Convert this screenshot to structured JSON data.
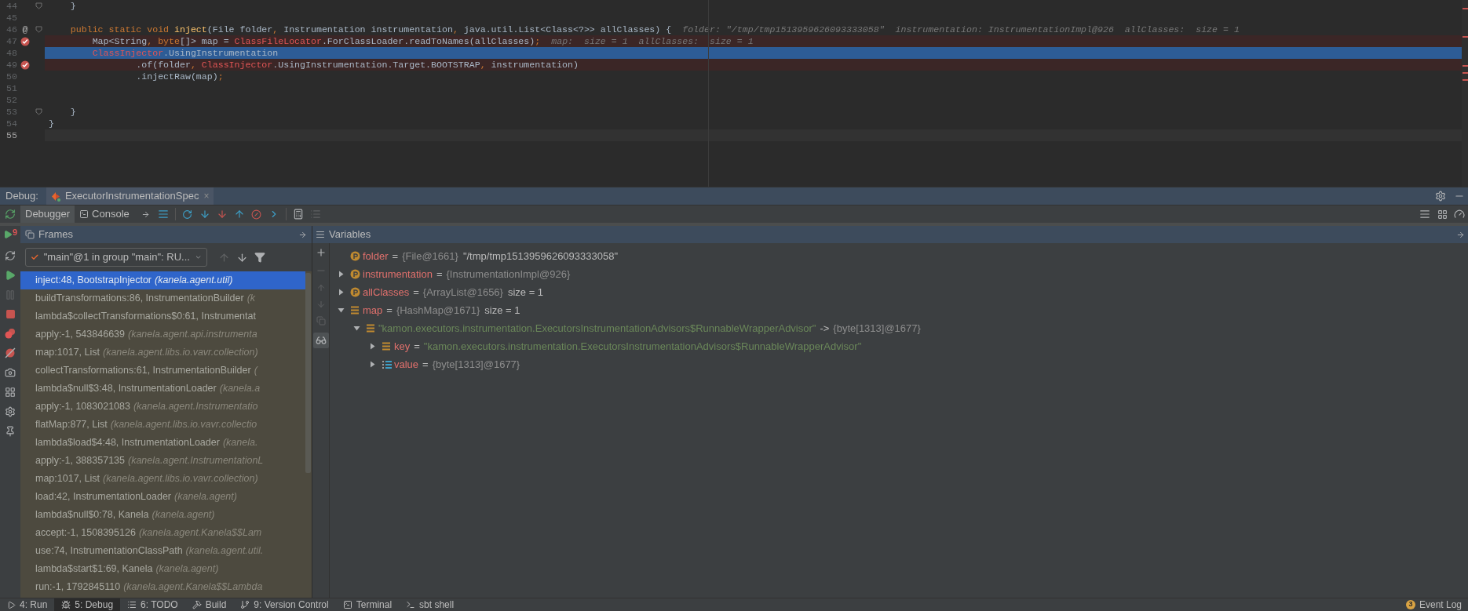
{
  "editor": {
    "lines": [
      {
        "number": "44",
        "breakpoint": false,
        "current": false,
        "highlighted": false,
        "fold": true,
        "tokens": [
          {
            "text": "    }",
            "kind": "plain"
          }
        ]
      },
      {
        "number": "45",
        "breakpoint": false,
        "current": false,
        "highlighted": false,
        "fold": false
      },
      {
        "number": "46",
        "breakpoint": false,
        "current": false,
        "highlighted": false,
        "marker": "@",
        "fold": true,
        "tokens": [
          {
            "text": "    public static void ",
            "kind": "keyword"
          },
          {
            "text": "inject",
            "kind": "method"
          },
          {
            "text": "(File folder",
            "kind": "plain"
          },
          {
            "text": ",",
            "kind": "keyword"
          },
          {
            "text": " Instrumentation instrumentation",
            "kind": "plain"
          },
          {
            "text": ",",
            "kind": "keyword"
          },
          {
            "text": " java.util.List<Class<?>> allClasses) {",
            "kind": "plain"
          },
          {
            "text": "folder: \"/tmp/tmp1513959626093333058\"  instrumentation: InstrumentationImpl@926  allClasses:  size = 1",
            "kind": "hint"
          }
        ]
      },
      {
        "number": "47",
        "breakpoint": true,
        "current": false,
        "highlighted": false,
        "fold": false,
        "tokens": [
          {
            "text": "        Map<String",
            "kind": "plain"
          },
          {
            "text": ",",
            "kind": "keyword"
          },
          {
            "text": " byte",
            "kind": "keyword"
          },
          {
            "text": "[]> map = ",
            "kind": "plain"
          },
          {
            "text": "ClassFileLocator",
            "kind": "class"
          },
          {
            "text": ".ForClassLoader.readToNames(allClasses)",
            "kind": "plain"
          },
          {
            "text": ";",
            "kind": "keyword"
          },
          {
            "text": "map:  size = 1  allClasses:  size = 1",
            "kind": "hint"
          }
        ]
      },
      {
        "number": "48",
        "breakpoint": false,
        "current": true,
        "highlighted": false,
        "fold": false,
        "tokens": [
          {
            "text": "        ClassInjector",
            "kind": "class"
          },
          {
            "text": ".UsingInstrumentation",
            "kind": "plain"
          }
        ]
      },
      {
        "number": "49",
        "breakpoint": true,
        "current": false,
        "highlighted": false,
        "fold": false,
        "tokens": [
          {
            "text": "                .of(folder",
            "kind": "plain"
          },
          {
            "text": ", ",
            "kind": "keyword"
          },
          {
            "text": "ClassInjector",
            "kind": "class"
          },
          {
            "text": ".UsingInstrumentation.Target.BOOTSTRAP",
            "kind": "plain"
          },
          {
            "text": ",",
            "kind": "keyword"
          },
          {
            "text": " instrumentation)",
            "kind": "plain"
          }
        ]
      },
      {
        "number": "50",
        "breakpoint": false,
        "current": false,
        "highlighted": false,
        "fold": false,
        "tokens": [
          {
            "text": "                .injectRaw(map)",
            "kind": "plain"
          },
          {
            "text": ";",
            "kind": "keyword"
          }
        ]
      },
      {
        "number": "51",
        "breakpoint": false,
        "current": false,
        "highlighted": false,
        "fold": false
      },
      {
        "number": "52",
        "breakpoint": false,
        "current": false,
        "highlighted": false,
        "fold": false
      },
      {
        "number": "53",
        "breakpoint": false,
        "current": false,
        "highlighted": false,
        "fold": true,
        "tokens": [
          {
            "text": "    }",
            "kind": "plain"
          }
        ]
      },
      {
        "number": "54",
        "breakpoint": false,
        "current": false,
        "highlighted": false,
        "fold": false,
        "tokens": [
          {
            "text": "}",
            "kind": "plain"
          }
        ]
      },
      {
        "number": "55",
        "breakpoint": false,
        "current": false,
        "highlighted": true,
        "fold": false
      }
    ]
  },
  "debug_bar": {
    "label": "Debug:",
    "session_tab": {
      "label": "ExecutorInstrumentationSpec",
      "close": "×"
    },
    "rerun_badge": "9"
  },
  "toolbar_tabs": [
    {
      "label": "Debugger",
      "selected": true
    },
    {
      "label": "Console",
      "selected": false
    }
  ],
  "frames": {
    "title": "Frames",
    "thread": "\"main\"@1 in group \"main\": RU...",
    "items": [
      {
        "method": "inject:48, BootstrapInjector",
        "package": "(kanela.agent.util)",
        "selected": true
      },
      {
        "method": "buildTransformations:86, InstrumentationBuilder",
        "package": "(k",
        "selected": false
      },
      {
        "method": "lambda$collectTransformations$0:61, Instrumentat",
        "selected": false
      },
      {
        "method": "apply:-1, 543846639",
        "package": "(kanela.agent.api.instrumenta",
        "selected": false
      },
      {
        "method": "map:1017, List",
        "package": "(kanela.agent.libs.io.vavr.collection)",
        "selected": false
      },
      {
        "method": "collectTransformations:61, InstrumentationBuilder",
        "package": "(",
        "selected": false
      },
      {
        "method": "lambda$null$3:48, InstrumentationLoader",
        "package": "(kanela.a",
        "selected": false
      },
      {
        "method": "apply:-1, 1083021083",
        "package": "(kanela.agent.Instrumentatio",
        "selected": false
      },
      {
        "method": "flatMap:877, List",
        "package": "(kanela.agent.libs.io.vavr.collectio",
        "selected": false
      },
      {
        "method": "lambda$load$4:48, InstrumentationLoader",
        "package": "(kanela.",
        "selected": false
      },
      {
        "method": "apply:-1, 388357135",
        "package": "(kanela.agent.InstrumentationL",
        "selected": false
      },
      {
        "method": "map:1017, List",
        "package": "(kanela.agent.libs.io.vavr.collection)",
        "selected": false
      },
      {
        "method": "load:42, InstrumentationLoader",
        "package": "(kanela.agent)",
        "selected": false
      },
      {
        "method": "lambda$null$0:78, Kanela",
        "package": "(kanela.agent)",
        "selected": false
      },
      {
        "method": "accept:-1, 1508395126",
        "package": "(kanela.agent.Kanela$$Lam",
        "selected": false
      },
      {
        "method": "use:74, InstrumentationClassPath",
        "package": "(kanela.agent.util.",
        "selected": false
      },
      {
        "method": "lambda$start$1:69, Kanela",
        "package": "(kanela.agent)",
        "selected": false
      },
      {
        "method": "run:-1, 1792845110",
        "package": "(kanela.agent.Kanela$$Lambda",
        "selected": false
      }
    ]
  },
  "variables": {
    "title": "Variables",
    "items": [
      {
        "name": "folder",
        "kind": "param",
        "separator": "=",
        "type": "{File@1661}",
        "value": "\"/tmp/tmp1513959626093333058\"",
        "string": false
      },
      {
        "name": "instrumentation",
        "kind": "param",
        "expanded": false,
        "separator": "=",
        "type": "{InstrumentationImpl@926}"
      },
      {
        "name": "allClasses",
        "kind": "param",
        "expanded": false,
        "separator": "=",
        "type": "{ArrayList@1656}",
        "value": "size = 1",
        "string": false
      },
      {
        "name": "map",
        "kind": "field",
        "expanded": true,
        "separator": "=",
        "type": "{HashMap@1671}",
        "value": "size = 1",
        "string": false,
        "children": [
          {
            "key": "\"kamon.executors.instrumentation.ExecutorsInstrumentationAdvisors$RunnableWrapperAdvisor\"",
            "kind": "field",
            "expanded": true,
            "separator": "->",
            "type": "{byte[1313]@1677}",
            "children": [
              {
                "name": "key",
                "kind": "field",
                "expanded": false,
                "separator": "=",
                "value": "\"kamon.executors.instrumentation.ExecutorsInstrumentationAdvisors$RunnableWrapperAdvisor\"",
                "string": true
              },
              {
                "name": "value",
                "kind": "array",
                "expanded": false,
                "separator": "=",
                "type": "{byte[1313]@1677}"
              }
            ]
          }
        ]
      }
    ]
  },
  "status_bar": {
    "items": [
      {
        "label": "4: Run",
        "selected": false
      },
      {
        "label": "5: Debug",
        "selected": true
      },
      {
        "label": "6: TODO",
        "selected": false
      },
      {
        "label": "Build",
        "selected": false
      },
      {
        "label": "9: Version Control",
        "selected": false
      },
      {
        "label": "Terminal",
        "selected": false
      },
      {
        "label": "sbt shell",
        "selected": false
      }
    ],
    "event_log": {
      "label": "Event Log",
      "count": "3"
    }
  }
}
